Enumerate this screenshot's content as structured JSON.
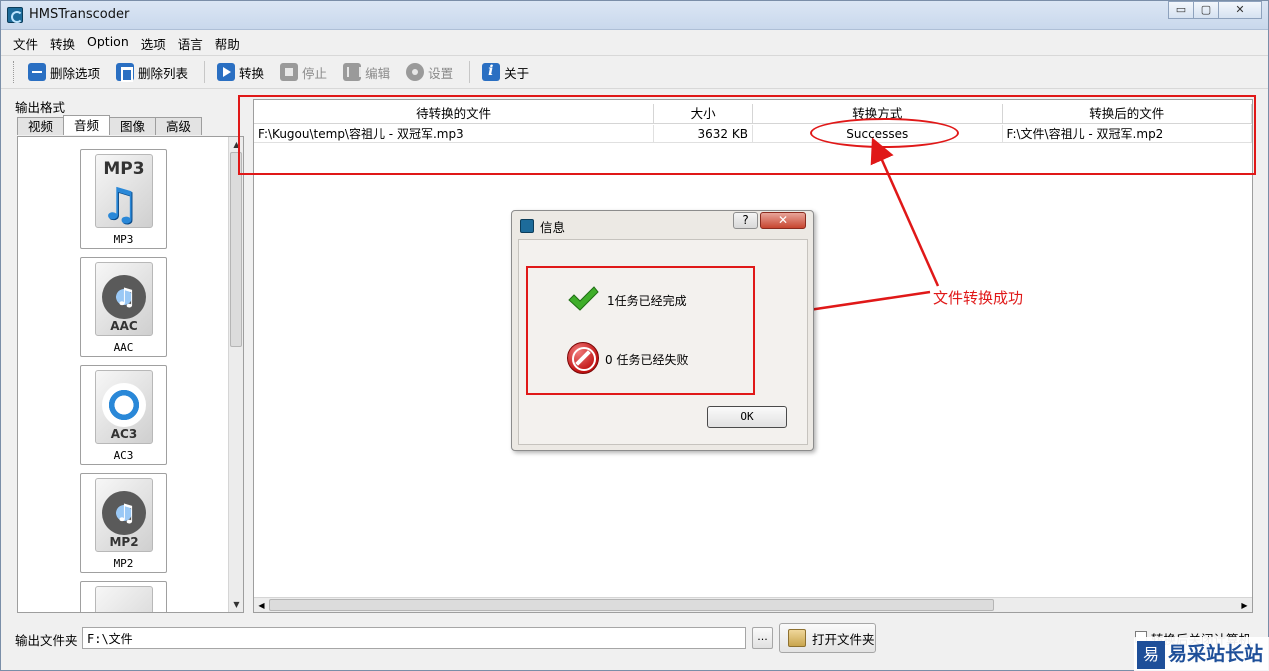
{
  "window": {
    "title": "HMSTranscoder",
    "min": "▭",
    "max": "▢",
    "close": "✕"
  },
  "menu": [
    "文件",
    "转换",
    "Option",
    "选项",
    "语言",
    "帮助"
  ],
  "toolbar": {
    "delete_item": "删除选项",
    "delete_list": "删除列表",
    "convert": "转换",
    "stop": "停止",
    "edit": "编辑",
    "settings": "设置",
    "about": "关于"
  },
  "left": {
    "label": "输出格式",
    "tabs": [
      "视频",
      "音频",
      "图像",
      "高级"
    ],
    "active_tab": "音频",
    "formats": [
      {
        "name": "MP3",
        "tag": "MP3"
      },
      {
        "name": "AAC",
        "tag": "AAC"
      },
      {
        "name": "AC3",
        "tag": "AC3"
      },
      {
        "name": "MP2",
        "tag": "MP2"
      }
    ]
  },
  "table": {
    "headers": [
      "待转换的文件",
      "大小",
      "转换方式",
      "转换后的文件"
    ],
    "rows": [
      {
        "source": "F:\\Kugou\\temp\\容祖儿 - 双冠军.mp3",
        "size": "3632 KB",
        "status": "Successes",
        "output": "F:\\文件\\容祖儿 - 双冠军.mp2"
      }
    ]
  },
  "dialog": {
    "title": "信息",
    "help": "?",
    "close": "✕",
    "success_msg": "1任务已经完成",
    "fail_msg": "0 任务已经失败",
    "ok": "OK"
  },
  "annotation": {
    "text": "文件转换成功",
    "color": "#e01818"
  },
  "bottom": {
    "output_label": "输出文件夹",
    "output_value": "F:\\文件",
    "browse": "...",
    "open_folder": "打开文件夹",
    "shutdown_label": "转换后关闭计算机"
  },
  "watermark": {
    "logo": "易",
    "text": "易采站长站"
  }
}
